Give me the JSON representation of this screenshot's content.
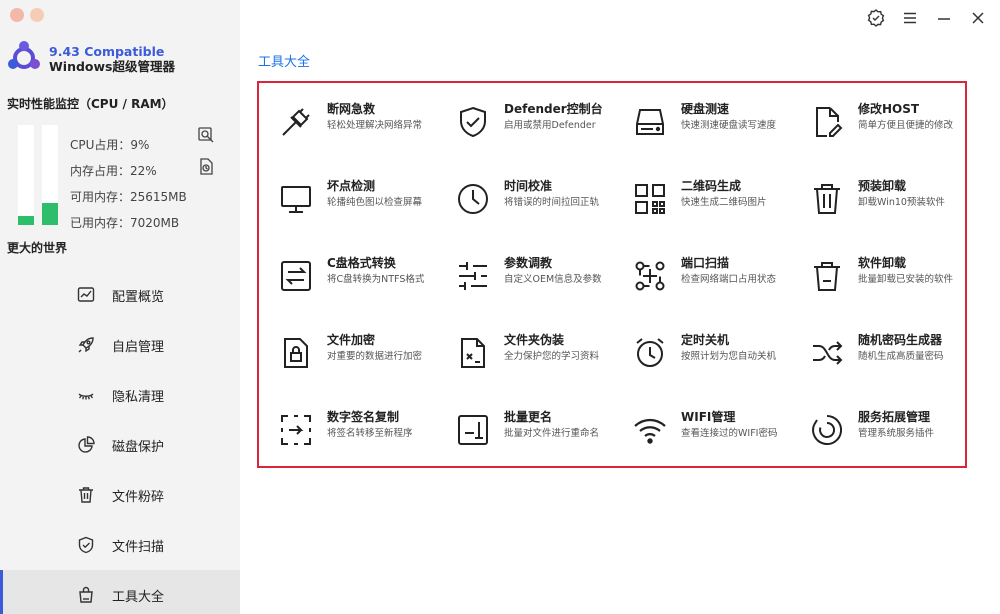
{
  "app": {
    "version_label": "9.43 Compatible",
    "subtitle": "Windows超级管理器"
  },
  "monitor": {
    "title": "实时性能监控（CPU / RAM）",
    "cpu_percent": 9,
    "mem_percent": 22,
    "cpu_text": "CPU占用：9%",
    "mem_text": "内存占用：22%",
    "free_text": "可用内存：25615MB",
    "used_text": "已用内存：7020MB",
    "bar_color": "#2ebd6b"
  },
  "world_label": "更大的世界",
  "sidebar": {
    "items": [
      {
        "label": "配置概览",
        "icon": "chart-icon"
      },
      {
        "label": "自启管理",
        "icon": "rocket-icon"
      },
      {
        "label": "隐私清理",
        "icon": "eye-closed-icon"
      },
      {
        "label": "磁盘保护",
        "icon": "pie-icon"
      },
      {
        "label": "文件粉碎",
        "icon": "trash-icon"
      },
      {
        "label": "文件扫描",
        "icon": "shield-check-icon"
      },
      {
        "label": "工具大全",
        "icon": "bag-icon",
        "active": true
      }
    ]
  },
  "main": {
    "section_title": "工具大全",
    "tools": [
      {
        "name": "断网急救",
        "desc": "轻松处理解决网络异常",
        "icon": "plug-icon"
      },
      {
        "name": "Defender控制台",
        "desc": "启用或禁用Defender",
        "icon": "shield-icon"
      },
      {
        "name": "硬盘测速",
        "desc": "快速测速硬盘读写速度",
        "icon": "harddisk-icon"
      },
      {
        "name": "修改HOST",
        "desc": "简单方便且便捷的修改",
        "icon": "file-edit-icon"
      },
      {
        "name": "坏点检测",
        "desc": "轮播纯色图以检查屏幕",
        "icon": "monitor-icon"
      },
      {
        "name": "时间校准",
        "desc": "将错误的时间拉回正轨",
        "icon": "clock-icon"
      },
      {
        "name": "二维码生成",
        "desc": "快速生成二维码图片",
        "icon": "qrcode-icon"
      },
      {
        "name": "预装卸载",
        "desc": "卸载Win10预装软件",
        "icon": "trash-icon"
      },
      {
        "name": "C盘格式转换",
        "desc": "将C盘转换为NTFS格式",
        "icon": "convert-icon"
      },
      {
        "name": "参数调教",
        "desc": "自定义OEM信息及参数",
        "icon": "sliders-icon"
      },
      {
        "name": "端口扫描",
        "desc": "检查网络端口占用状态",
        "icon": "port-scan-icon"
      },
      {
        "name": "软件卸载",
        "desc": "批量卸载已安装的软件",
        "icon": "trash-alt-icon"
      },
      {
        "name": "文件加密",
        "desc": "对重要的数据进行加密",
        "icon": "file-lock-icon"
      },
      {
        "name": "文件夹伪装",
        "desc": "全力保护您的学习资料",
        "icon": "file-disguise-icon"
      },
      {
        "name": "定时关机",
        "desc": "按照计划为您自动关机",
        "icon": "alarm-icon"
      },
      {
        "name": "随机密码生成器",
        "desc": "随机生成高质量密码",
        "icon": "shuffle-icon"
      },
      {
        "name": "数字签名复制",
        "desc": "将签名转移至新程序",
        "icon": "signature-copy-icon"
      },
      {
        "name": "批量更名",
        "desc": "批量对文件进行重命名",
        "icon": "rename-icon"
      },
      {
        "name": "WIFI管理",
        "desc": "查看连接过的WIFI密码",
        "icon": "wifi-icon"
      },
      {
        "name": "服务拓展管理",
        "desc": "管理系统服务插件",
        "icon": "service-icon"
      }
    ]
  }
}
